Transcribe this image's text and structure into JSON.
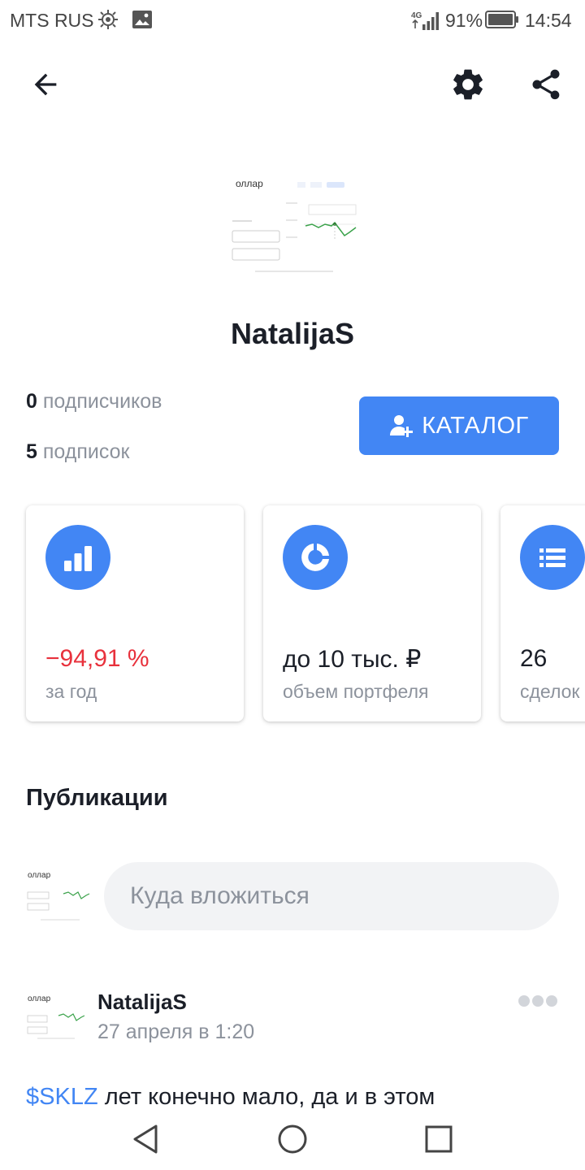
{
  "status_bar": {
    "carrier": "MTS RUS",
    "network": "4G",
    "battery": "91%",
    "time": "14:54"
  },
  "profile": {
    "name": "NatalijaS",
    "avatar_caption": "оллар",
    "followers_count": "0",
    "followers_label": "подписчиков",
    "following_count": "5",
    "following_label": "подписок",
    "catalog_label": "КАТАЛОГ"
  },
  "cards": [
    {
      "icon": "bar-chart-icon",
      "value": "−94,91 %",
      "label": "за год",
      "value_color": "#e8313c"
    },
    {
      "icon": "donut-chart-icon",
      "value": "до 10 тыс. ₽",
      "label": "объем портфеля"
    },
    {
      "icon": "list-icon",
      "value": "26",
      "label": "сделок"
    }
  ],
  "publications": {
    "title": "Публикации",
    "compose_placeholder": "Куда вложиться"
  },
  "post": {
    "author": "NatalijaS",
    "date": "27 апреля в 1:20",
    "ticker": "$SKLZ",
    "text": " лет конечно мало, да и в этом"
  },
  "colors": {
    "accent": "#4286f4",
    "negative": "#e8313c",
    "text": "#1b1f28",
    "muted": "#8c929c"
  }
}
